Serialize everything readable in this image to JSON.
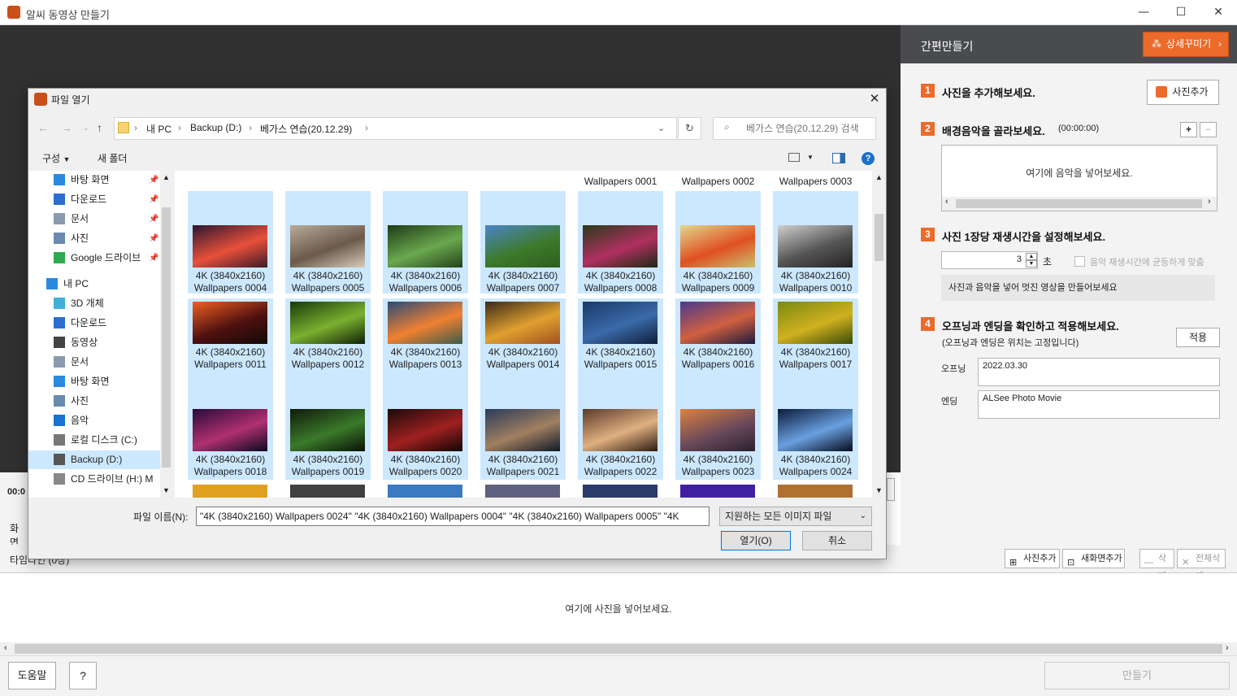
{
  "window": {
    "title": "알씨 동영상 만들기"
  },
  "right_panel": {
    "title": "간편만들기",
    "detail_button": "상세꾸미기",
    "step1": {
      "num": "1",
      "text": "사진을 추가해보세요.",
      "button": "사진추가"
    },
    "step2": {
      "num": "2",
      "text": "배경음악을 골라보세요.",
      "duration": "(00:00:00)",
      "drop_hint": "여기에 음악을 넣어보세요.",
      "add": "+",
      "remove": "−"
    },
    "step3": {
      "num": "3",
      "text": "사진 1장당 재생시간을 설정해보세요.",
      "seconds_value": "3",
      "seconds_unit": "초",
      "fit_label": "음악 재생시간에 균등하게 맞춤",
      "hint": "사진과 음악을 넣어 멋진 영상을 만들어보세요"
    },
    "step4": {
      "num": "4",
      "text": "오프닝과 엔딩을 확인하고 적용해보세요.",
      "subtext": "(오프닝과 엔딩은 위치는 고정입니다)",
      "apply": "적용",
      "opening_label": "오프닝",
      "opening_value": "2022.03.30",
      "ending_label": "엔딩",
      "ending_value": "ALSee Photo Movie"
    }
  },
  "left_strip": {
    "time": "00:0",
    "screen": "화면"
  },
  "timeline": {
    "label": "타임라인 (0장)",
    "buttons": [
      "사진추가",
      "새화면추가",
      "삭제",
      "전체삭제"
    ],
    "drop_hint": "여기에 사진을 넣어보세요."
  },
  "bottom": {
    "help": "도움말",
    "question": "?",
    "make": "만들기"
  },
  "dialog": {
    "title": "파일 열기",
    "breadcrumb": [
      "내 PC",
      "Backup (D:)",
      "베가스 연습(20.12.29)"
    ],
    "search_placeholder": "베가스 연습(20.12.29) 검색",
    "organize": "구성",
    "new_folder": "새 폴더",
    "nav": [
      {
        "label": "바탕 화면",
        "icon": "desktop-icon",
        "pinned": true
      },
      {
        "label": "다운로드",
        "icon": "download-icon",
        "pinned": true
      },
      {
        "label": "문서",
        "icon": "document-icon",
        "pinned": true
      },
      {
        "label": "사진",
        "icon": "picture-icon",
        "pinned": true
      },
      {
        "label": "Google 드라이브",
        "icon": "google-drive-icon",
        "pinned": true
      },
      {
        "label": "내 PC",
        "icon": "pc-icon",
        "pinned": false
      },
      {
        "label": "3D 개체",
        "icon": "3d-objects-icon",
        "pinned": false
      },
      {
        "label": "다운로드",
        "icon": "download-icon",
        "pinned": false
      },
      {
        "label": "동영상",
        "icon": "video-icon",
        "pinned": false
      },
      {
        "label": "문서",
        "icon": "document-icon",
        "pinned": false
      },
      {
        "label": "바탕 화면",
        "icon": "desktop-icon",
        "pinned": false
      },
      {
        "label": "사진",
        "icon": "picture-icon",
        "pinned": false
      },
      {
        "label": "음악",
        "icon": "music-icon",
        "pinned": false
      },
      {
        "label": "로컬 디스크 (C:)",
        "icon": "local-disk-icon",
        "pinned": false
      },
      {
        "label": "Backup (D:)",
        "icon": "drive-icon",
        "pinned": false
      },
      {
        "label": "CD 드라이브 (H:) M",
        "icon": "cd-drive-icon",
        "pinned": false
      }
    ],
    "top_row": [
      "Wallpapers 0001",
      "Wallpapers 0002",
      "Wallpapers 0003"
    ],
    "files": [
      {
        "name": "4K (3840x2160)\nWallpapers 0004",
        "colors": [
          "#2b1530",
          "#e8503a",
          "#3b1a2a"
        ]
      },
      {
        "name": "4K (3840x2160)\nWallpapers 0005",
        "colors": [
          "#b9aa98",
          "#6b5a4a",
          "#d8cdbd"
        ]
      },
      {
        "name": "4K (3840x2160)\nWallpapers 0006",
        "colors": [
          "#1e3a15",
          "#6aa84f",
          "#24421a"
        ]
      },
      {
        "name": "4K (3840x2160)\nWallpapers 0007",
        "colors": [
          "#4a86c8",
          "#3d7a2a",
          "#2e5e1e"
        ]
      },
      {
        "name": "4K (3840x2160)\nWallpapers 0008",
        "colors": [
          "#2a3a1a",
          "#b03060",
          "#1c2a12"
        ]
      },
      {
        "name": "4K (3840x2160)\nWallpapers 0009",
        "colors": [
          "#e0d890",
          "#e05020",
          "#c8c070"
        ]
      },
      {
        "name": "4K (3840x2160)\nWallpapers 0010",
        "colors": [
          "#cfcfcf",
          "#555555",
          "#222222"
        ]
      },
      {
        "name": "4K (3840x2160)\nWallpapers 0011",
        "colors": [
          "#f06020",
          "#501010",
          "#120808"
        ]
      },
      {
        "name": "4K (3840x2160)\nWallpapers 0012",
        "colors": [
          "#1a3a0a",
          "#7ab030",
          "#0e2005"
        ]
      },
      {
        "name": "4K (3840x2160)\nWallpapers 0013",
        "colors": [
          "#2a4a7a",
          "#f08030",
          "#3a5a4a"
        ]
      },
      {
        "name": "4K (3840x2160)\nWallpapers 0014",
        "colors": [
          "#3a2a1a",
          "#e0a030",
          "#a05020"
        ]
      },
      {
        "name": "4K (3840x2160)\nWallpapers 0015",
        "colors": [
          "#1a3a6a",
          "#3a6aa8",
          "#0e1e3a"
        ]
      },
      {
        "name": "4K (3840x2160)\nWallpapers 0016",
        "colors": [
          "#4a3a8a",
          "#d06040",
          "#1a1a3a"
        ]
      },
      {
        "name": "4K (3840x2160)\nWallpapers 0017",
        "colors": [
          "#7a8a10",
          "#d0b020",
          "#3a4a08"
        ]
      },
      {
        "name": "4K (3840x2160)\nWallpapers 0018",
        "colors": [
          "#2a0a3a",
          "#b03070",
          "#0a0a20"
        ]
      },
      {
        "name": "4K (3840x2160)\nWallpapers 0019",
        "colors": [
          "#0e1a0a",
          "#3a7a2a",
          "#0a1206"
        ]
      },
      {
        "name": "4K (3840x2160)\nWallpapers 0020",
        "colors": [
          "#1a0a0a",
          "#a02020",
          "#100505"
        ]
      },
      {
        "name": "4K (3840x2160)\nWallpapers 0021",
        "colors": [
          "#2a3a5a",
          "#a08060",
          "#101828"
        ]
      },
      {
        "name": "4K (3840x2160)\nWallpapers 0022",
        "colors": [
          "#5a3a2a",
          "#e0b080",
          "#2a1a10"
        ]
      },
      {
        "name": "4K (3840x2160)\nWallpapers 0023",
        "colors": [
          "#e08040",
          "#6a4a5a",
          "#2a2030"
        ]
      },
      {
        "name": "4K (3840x2160)\nWallpapers 0024",
        "colors": [
          "#0a1a3a",
          "#6aa0e0",
          "#050a1a"
        ]
      }
    ],
    "bottom_row_colors": [
      "#e0a020",
      "#404040",
      "#3a7ac0",
      "#606080",
      "#2a3a6a",
      "#4020a0",
      "#b07030"
    ],
    "filename_label": "파일 이름(N):",
    "filename_value": "\"4K (3840x2160) Wallpapers 0024\" \"4K (3840x2160) Wallpapers 0004\" \"4K (3840x2160) Wallpapers 0005\" \"4K",
    "filetype_value": "지원하는 모든 이미지 파일",
    "open_button": "열기(O)",
    "cancel_button": "취소"
  }
}
